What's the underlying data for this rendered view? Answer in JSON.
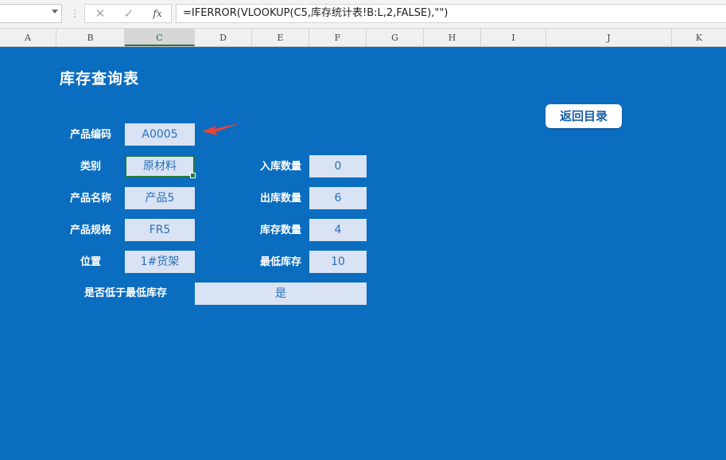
{
  "formula_bar": {
    "cancel_icon": "✕",
    "enter_icon": "✓",
    "fx_label": "fx",
    "formula": "=IFERROR(VLOOKUP(C5,库存统计表!B:L,2,FALSE),\"\")"
  },
  "columns": [
    "A",
    "B",
    "C",
    "D",
    "E",
    "F",
    "G",
    "H",
    "I",
    "J",
    "K"
  ],
  "selected_column": "C",
  "sheet": {
    "title": "库存查询表",
    "back_button": "返回目录",
    "fields": {
      "product_code": {
        "label": "产品编码",
        "value": "A0005"
      },
      "category": {
        "label": "类别",
        "value": "原材料"
      },
      "product_name": {
        "label": "产品名称",
        "value": "产品5"
      },
      "spec": {
        "label": "产品规格",
        "value": "FR5"
      },
      "location": {
        "label": "位置",
        "value": "1#货架"
      },
      "in_qty": {
        "label": "入库数量",
        "value": "0"
      },
      "out_qty": {
        "label": "出库数量",
        "value": "6"
      },
      "stock_qty": {
        "label": "库存数量",
        "value": "4"
      },
      "min_stock": {
        "label": "最低库存",
        "value": "10"
      },
      "below_min": {
        "label": "是否低于最低库存",
        "value": "是"
      }
    }
  },
  "colors": {
    "sheet_background": "#0b6dbf",
    "value_cell": "#d9e3f3",
    "value_text": "#2a6fb8",
    "selection": "#1e7a3e",
    "arrow": "#e8433a"
  }
}
